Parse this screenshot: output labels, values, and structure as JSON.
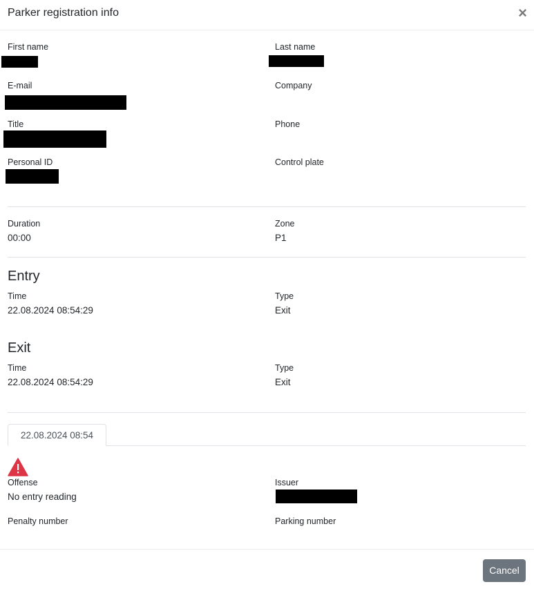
{
  "modal": {
    "title": "Parker registration info",
    "close_symbol": "×"
  },
  "parker": {
    "first_name_label": "First name",
    "last_name_label": "Last name",
    "email_label": "E-mail",
    "company_label": "Company",
    "title_label": "Title",
    "phone_label": "Phone",
    "personal_id_label": "Personal ID",
    "control_plate_label": "Control plate"
  },
  "summary": {
    "duration_label": "Duration",
    "duration_value": "00:00",
    "zone_label": "Zone",
    "zone_value": "P1"
  },
  "entry": {
    "heading": "Entry",
    "time_label": "Time",
    "time_value": "22.08.2024 08:54:29",
    "type_label": "Type",
    "type_value": "Exit"
  },
  "exit": {
    "heading": "Exit",
    "time_label": "Time",
    "time_value": "22.08.2024 08:54:29",
    "type_label": "Type",
    "type_value": "Exit"
  },
  "tabs": [
    {
      "label": "22.08.2024 08:54"
    }
  ],
  "offense": {
    "icon": "warning-triangle-icon",
    "offense_label": "Offense",
    "offense_value": "No entry reading",
    "issuer_label": "Issuer",
    "penalty_number_label": "Penalty number",
    "parking_number_label": "Parking number"
  },
  "footer": {
    "cancel_label": "Cancel"
  },
  "colors": {
    "warning": "#dc3545",
    "cancel_button": "#6c757d",
    "divider": "#dee2e6"
  }
}
